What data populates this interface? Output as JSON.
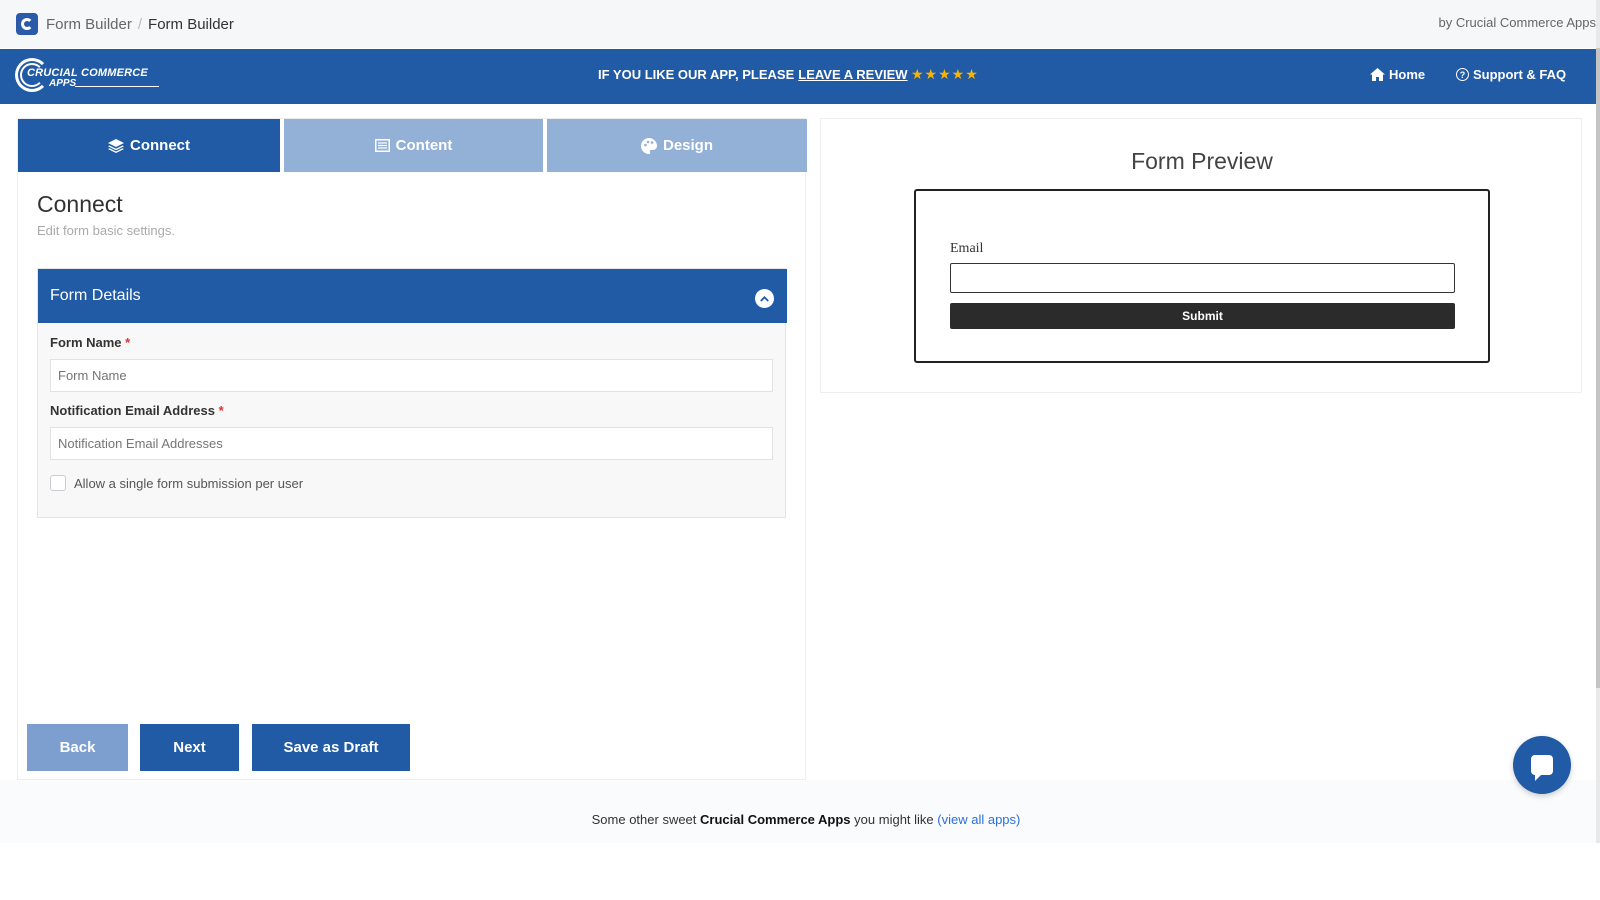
{
  "topbar": {
    "crumb_parent": "Form Builder",
    "crumb_separator": "/",
    "crumb_current": "Form Builder",
    "by_line": "by Crucial Commerce Apps"
  },
  "banner": {
    "logo_line1": "CRUCIAL COMMERCE",
    "logo_line2": "APPS",
    "review_text": "IF YOU LIKE OUR APP, PLEASE",
    "review_link": "LEAVE A REVIEW",
    "stars": "★★★★★",
    "nav_home": "Home",
    "nav_support": "Support & FAQ"
  },
  "tabs": [
    {
      "label": "Connect",
      "icon": "layers-icon",
      "active": true
    },
    {
      "label": "Content",
      "icon": "list-icon",
      "active": false
    },
    {
      "label": "Design",
      "icon": "palette-icon",
      "active": false
    }
  ],
  "section": {
    "title": "Connect",
    "subtitle": "Edit form basic settings."
  },
  "form_details": {
    "header": "Form Details",
    "form_name_label": "Form Name",
    "form_name_placeholder": "Form Name",
    "form_name_value": "",
    "notification_label": "Notification Email Address",
    "notification_placeholder": "Notification Email Addresses",
    "notification_value": "",
    "required_mark": "*",
    "single_submission_label": "Allow a single form submission per user",
    "single_submission_checked": false
  },
  "buttons": {
    "back": "Back",
    "next": "Next",
    "save_draft": "Save as Draft"
  },
  "preview": {
    "title": "Form Preview",
    "email_label": "Email",
    "submit_label": "Submit"
  },
  "footer": {
    "prefix": "Some other sweet",
    "brand": "Crucial Commerce Apps",
    "middle": "you might like",
    "link": "(view all apps)"
  },
  "colors": {
    "brand_blue": "#215aa5",
    "tab_inactive": "#93b0d6",
    "back_button": "#7d9fcf",
    "star_gold": "#f7b500",
    "required_red": "#dd3333",
    "link_blue": "#2a6fdb"
  }
}
